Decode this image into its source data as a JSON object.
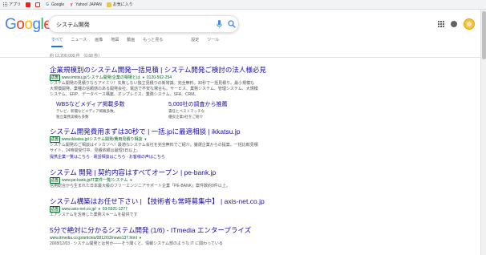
{
  "bookmarks": [
    {
      "label": "アプリ",
      "icon": "apps-icon"
    },
    {
      "label": "",
      "icon": "youtube-icon"
    },
    {
      "label": "",
      "icon": "gmail-icon"
    },
    {
      "label": "Google",
      "icon": "google-icon"
    },
    {
      "label": "Yahoo! JAPAN",
      "icon": "yahoo-icon"
    },
    {
      "label": "お気に入り",
      "icon": "folder-icon"
    }
  ],
  "logo": {
    "letters": [
      "G",
      "o",
      "o",
      "g",
      "l",
      "e"
    ],
    "colors": [
      "#4285f4",
      "#ea4335",
      "#fbbc05",
      "#4285f4",
      "#34a853",
      "#ea4335"
    ]
  },
  "search": {
    "value": "システム開発"
  },
  "tabs": [
    {
      "label": "すべて",
      "active": true
    },
    {
      "label": "ニュース"
    },
    {
      "label": "画像"
    },
    {
      "label": "地図"
    },
    {
      "label": "動画"
    },
    {
      "label": "もっと見る"
    },
    {
      "label": "設定"
    },
    {
      "label": "ツール"
    }
  ],
  "stats": "約 12,200,000 件 （0.68 秒）",
  "ad_label": "広告",
  "results": [
    {
      "title": "企業規模別のシステム開発一括見積 | システム開発ご検討の法人様必見",
      "url": "www.imitsu.jp/システム開発/企業の相場とは",
      "phone": "0120-562-254",
      "desc": "システム開発の見積りならアイミツ！失敗しない独立見積りの新常識。完全無料。30秒で一括見積り。最小規模も大規模開発。業種の信頼感のある開発会社。電話で不安な場合も。サービス、業務システム、管理システム、大規模システム、ERP、データベース構築、オンプレミス、業務システム、SFA、CRM。",
      "sitelinks": [
        {
          "title": "WBSなどメディア掲載多数",
          "desc": [
            "テレビ、新聞などメディア掲載多数。",
            "独立業務実績も多数"
          ]
        },
        {
          "title": "5,000社の調査から推薦",
          "desc": [
            "責任とベストマッチな",
            "優良企業3社をご紹介"
          ]
        }
      ]
    },
    {
      "title": "システム開発費用まずは30秒で | 一括.jpに最適相談 | ikkatsu.jp",
      "url": "www.ikkatsu.jp/システム開発/費用見積り相談",
      "desc": "システム開発のご相談はイッカツへ！最適なシステム会社を完全無料でご紹介。厳選企業からの提案。一括比較見積サイト。24時間受付中。見積依頼は最短5日以上。",
      "links": "提携企業一覧はこちら · 電話相談はこちら · お客様の声はこちら"
    },
    {
      "title": "システム 開発 | 契約内容はすべてオープン | pe-bank.jp",
      "url": "www.pe-bank.jp/IT案件一覧/システム",
      "desc": "信用総合から生まれた日本最大級のフリーエンジニアサポート企業「PE-BANK」案件数約9件以上。"
    },
    {
      "title": "システム構築はお任せ下さい | 【技術者も常時募集中】 | axis-net.co.jp",
      "url": "www.axis-net.co.jp/",
      "phone": "03-5921-1277",
      "desc": "エアシステムを活用した業務スキームを提供です"
    },
    {
      "title": "5分で絶対に分かるシステム開発 (1/6) - ITmedia エンタープライズ",
      "url": "www.itmedia.co.jp/articles/0812/03/news137.html",
      "desc": "2008/12/03 - システム開発とは何か——そう聞くと、情報システム部のような IT に関わっている"
    }
  ],
  "colors": {
    "link": "#1a0dab",
    "url": "#006621",
    "accent": "#1a73e8"
  }
}
